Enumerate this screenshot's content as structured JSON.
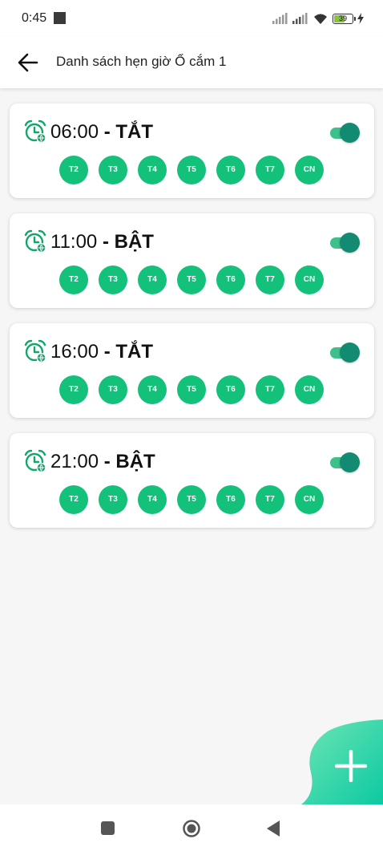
{
  "status_bar": {
    "time": "0:45",
    "battery": "39"
  },
  "app_bar": {
    "title": "Danh sách hẹn giờ Ổ cắm 1"
  },
  "colors": {
    "accent": "#13c17a",
    "toggle_knob": "#138a72",
    "toggle_track": "#3ec08a"
  },
  "schedules": [
    {
      "time": "06:00",
      "separator": " - ",
      "state": "TẮT",
      "enabled": true,
      "days": [
        "T2",
        "T3",
        "T4",
        "T5",
        "T6",
        "T7",
        "CN"
      ]
    },
    {
      "time": "11:00",
      "separator": " - ",
      "state": "BẬT",
      "enabled": true,
      "days": [
        "T2",
        "T3",
        "T4",
        "T5",
        "T6",
        "T7",
        "CN"
      ]
    },
    {
      "time": "16:00",
      "separator": " - ",
      "state": "TẮT",
      "enabled": true,
      "days": [
        "T2",
        "T3",
        "T4",
        "T5",
        "T6",
        "T7",
        "CN"
      ]
    },
    {
      "time": "21:00",
      "separator": " - ",
      "state": "BẬT",
      "enabled": true,
      "days": [
        "T2",
        "T3",
        "T4",
        "T5",
        "T6",
        "T7",
        "CN"
      ]
    }
  ],
  "fab": {
    "icon": "plus-icon"
  },
  "nav": {
    "recent_icon": "square-icon",
    "home_icon": "circle-icon",
    "back_icon": "triangle-back-icon"
  }
}
